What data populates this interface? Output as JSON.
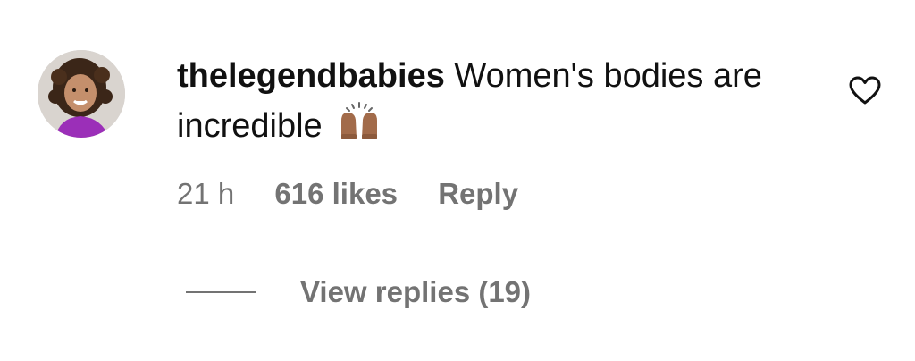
{
  "comment": {
    "username": "thelegendbabies",
    "text": "Women's bodies are incredible",
    "emoji_icon": "raising-hands-emoji",
    "time": "21 h",
    "likes": "616 likes",
    "reply_label": "Reply",
    "like_icon": "heart-outline-icon"
  },
  "replies": {
    "label": "View replies (19)"
  },
  "colors": {
    "text": "#111111",
    "secondary": "#737373",
    "background": "#ffffff"
  }
}
